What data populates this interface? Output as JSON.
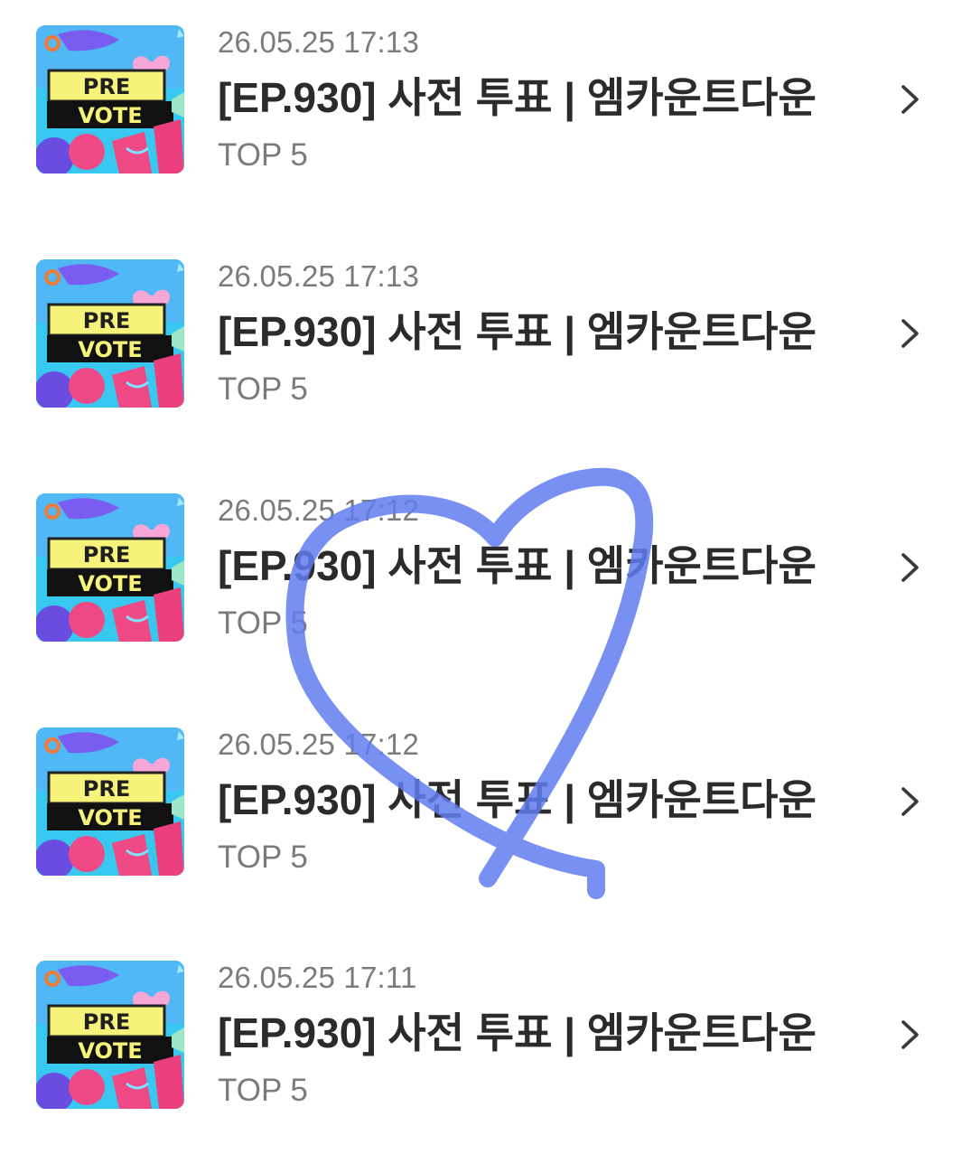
{
  "items": [
    {
      "date": "26.05.25 17:13",
      "title": "[EP.930] 사전 투표 | 엠카운트다운",
      "subtitle": "TOP 5",
      "thumbnail": {
        "line1": "PRE",
        "line2": "VOTE"
      }
    },
    {
      "date": "26.05.25 17:13",
      "title": "[EP.930] 사전 투표 | 엠카운트다운",
      "subtitle": "TOP 5",
      "thumbnail": {
        "line1": "PRE",
        "line2": "VOTE"
      }
    },
    {
      "date": "26.05.25 17:12",
      "title": "[EP.930] 사전 투표 | 엠카운트다운",
      "subtitle": "TOP 5",
      "thumbnail": {
        "line1": "PRE",
        "line2": "VOTE"
      }
    },
    {
      "date": "26.05.25 17:12",
      "title": "[EP.930] 사전 투표 | 엠카운트다운",
      "subtitle": "TOP 5",
      "thumbnail": {
        "line1": "PRE",
        "line2": "VOTE"
      }
    },
    {
      "date": "26.05.25 17:11",
      "title": "[EP.930] 사전 투표 | 엠카운트다운",
      "subtitle": "TOP 5",
      "thumbnail": {
        "line1": "PRE",
        "line2": "VOTE"
      }
    }
  ],
  "icons": {
    "row_arrow": "chevron-right-icon",
    "overlay": "heart-doodle-icon"
  },
  "colors": {
    "background": "#ffffff",
    "title_text": "#2b2b2b",
    "secondary_text": "#7b7b7b",
    "chevron": "#3a3a3a",
    "heart_stroke": "#5f7cf0",
    "thumb_sky": "#35c8ef",
    "thumb_yellow": "#f6f27a",
    "thumb_pink": "#f04a86",
    "thumb_purple": "#6a4de0"
  }
}
